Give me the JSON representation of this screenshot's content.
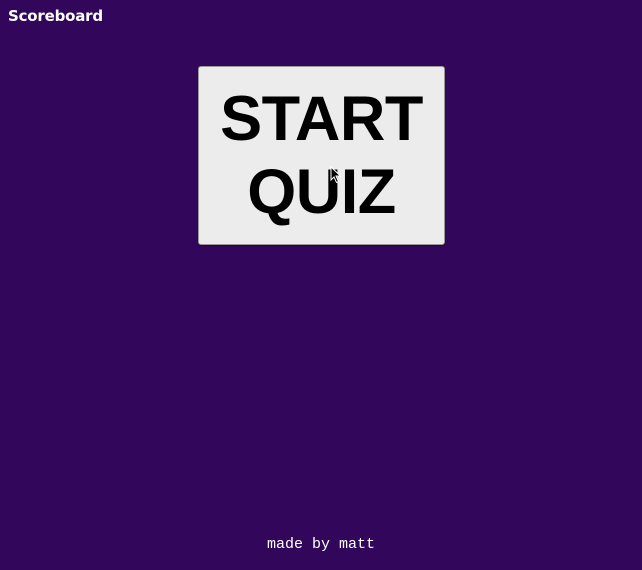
{
  "header": {
    "scoreboard_label": "Scoreboard"
  },
  "main": {
    "start_button": {
      "line1": "START",
      "line2": "QUIZ"
    }
  },
  "footer": {
    "credit": "made by matt"
  },
  "colors": {
    "background": "#32075b",
    "button_background": "#ececec",
    "text_light": "#ffffff",
    "text_dark": "#000000"
  },
  "icons": {
    "cursor": "mouse-pointer-icon"
  }
}
